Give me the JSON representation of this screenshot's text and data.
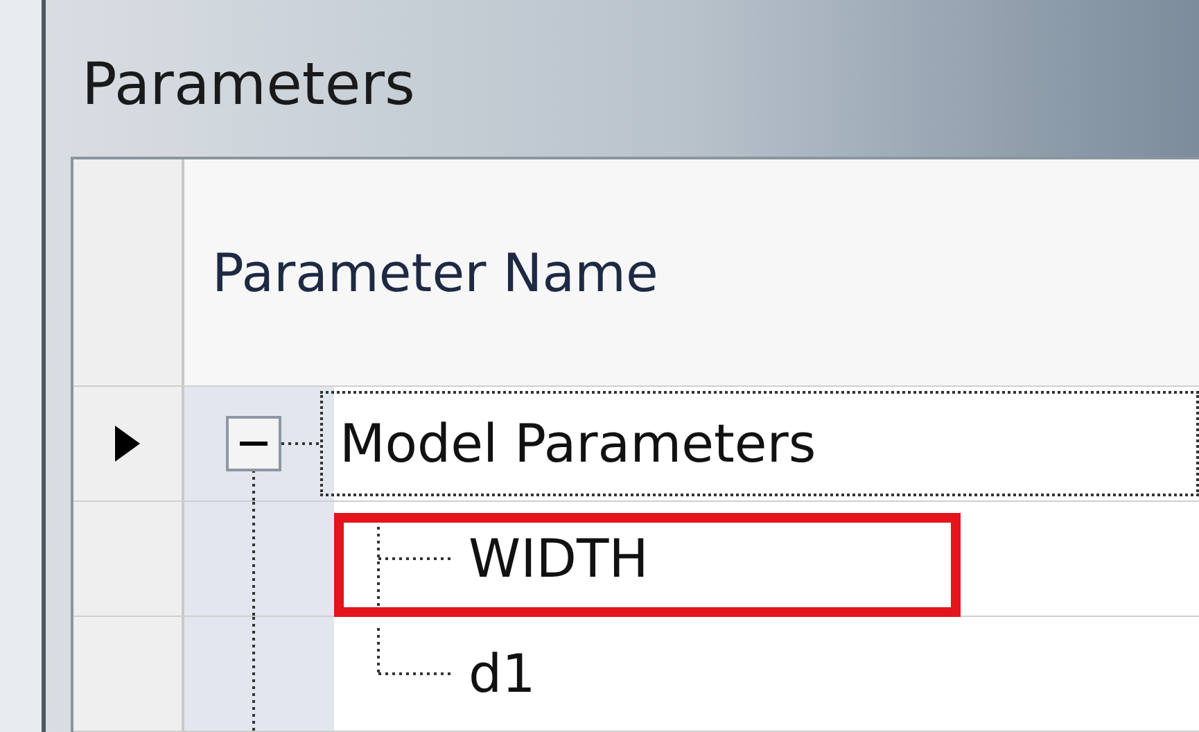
{
  "window": {
    "title": "Parameters"
  },
  "grid": {
    "columns": [
      "Parameter Name"
    ],
    "rows": [
      {
        "name": "Model Parameters",
        "current": true,
        "expanded": true,
        "children": [
          {
            "name": "WIDTH",
            "current": false,
            "highlighted": true
          },
          {
            "name": "d1",
            "current": false,
            "highlighted": false
          }
        ]
      }
    ]
  }
}
